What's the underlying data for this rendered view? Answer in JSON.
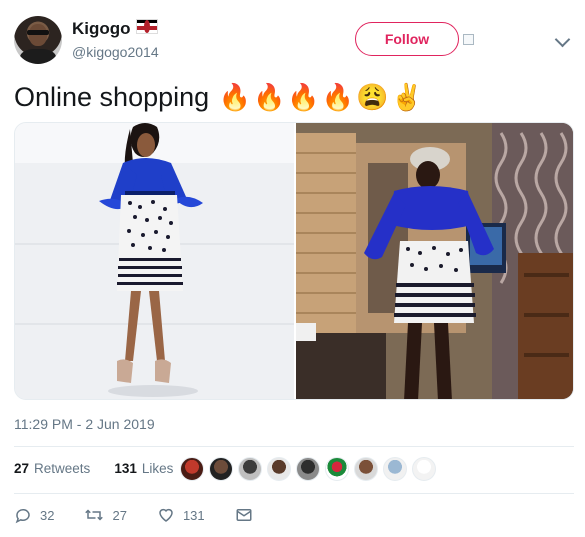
{
  "tweet": {
    "display_name": "Kigogo",
    "handle": "@kigogo2014",
    "follow_label": "Follow",
    "text": "Online shopping",
    "emojis": [
      "🔥",
      "🔥",
      "🔥",
      "🔥",
      "😩",
      "✌️"
    ],
    "timestamp": "11:29 PM - 2 Jun 2019"
  },
  "stats": {
    "retweets_count": "27",
    "retweets_label": "Retweets",
    "likes_count": "131",
    "likes_label": "Likes"
  },
  "actions": {
    "reply_count": "32",
    "retweet_count": "27",
    "like_count": "131"
  },
  "colors": {
    "follow_accent": "#e0245e",
    "meta_text": "#657786",
    "dress_blue": "#1f3fc9"
  },
  "icons": [
    "flag-kenya-icon",
    "chevron-down-icon",
    "reply-icon",
    "retweet-icon",
    "heart-icon",
    "envelope-icon"
  ]
}
